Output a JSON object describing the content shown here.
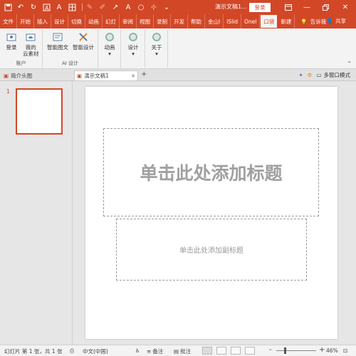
{
  "titlebar": {
    "doc_title": "演示文稿1...",
    "login_label": "登录"
  },
  "tabs": [
    "文件",
    "开始",
    "插入",
    "设计",
    "切换",
    "动画",
    "幻灯",
    "审阅",
    "视图",
    "录制",
    "开发",
    "帮助",
    "金山I",
    "iSlid",
    "Onel",
    "口袋",
    "新建"
  ],
  "active_tab": "口袋",
  "tell_me": "告诉我",
  "share_label": "共享",
  "ribbon": {
    "account": {
      "login": "登录",
      "my_assets_line1": "我的",
      "my_assets_line2": "云素材",
      "group": "账户"
    },
    "ai": {
      "smart_graphic": "智能图文",
      "smart_design": "智能设计",
      "group": "AI 设计"
    },
    "animation": "动画",
    "design": "设计",
    "about": "关于"
  },
  "doc_tabs": {
    "tab1": "简介头图",
    "tab2": "演示文稿1",
    "multi_window": "多窗口模式"
  },
  "slide_panel": {
    "slide_number": "1"
  },
  "slide": {
    "title_placeholder": "单击此处添加标题",
    "subtitle_placeholder": "单击此处添加副标题"
  },
  "status": {
    "slide_info": "幻灯片 第 1 张，共 1 张",
    "language": "中文(中国)",
    "notes": "备注",
    "comments": "批注",
    "zoom": "46%",
    "zoom_minus": "-",
    "zoom_plus": "+"
  },
  "colors": {
    "accent": "#d24726"
  }
}
